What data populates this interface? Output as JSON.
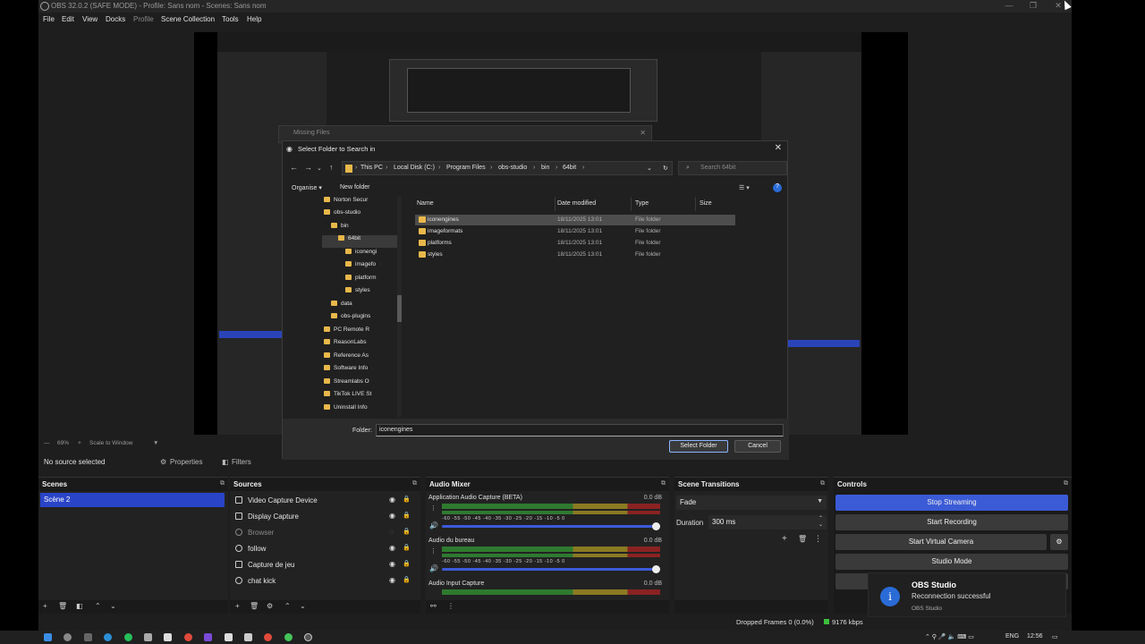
{
  "window": {
    "title": "OBS 32.0.2 (SAFE MODE) - Profile: Sans nom - Scenes: Sans nom",
    "menu": [
      "File",
      "Edit",
      "View",
      "Docks",
      "Profile",
      "Scene Collection",
      "Tools",
      "Help"
    ]
  },
  "missing_dialog": {
    "title": "Missing Files"
  },
  "folder_dialog": {
    "title": "Select Folder to Search in",
    "breadcrumb": [
      "This PC",
      "Local Disk (C:)",
      "Program Files",
      "obs-studio",
      "bin",
      "64bit"
    ],
    "search_placeholder": "Search 64bit",
    "toolbar": {
      "organise": "Organise ▾",
      "new_folder": "New folder"
    },
    "tree": [
      "Norton Secur",
      "obs-studio",
      "bin",
      "64bit",
      "iconengi",
      "imagefo",
      "platform",
      "styles",
      "data",
      "obs-plugins",
      "PC Remote R",
      "ReasonLabs",
      "Reference As",
      "Software Info",
      "Streamlabs O",
      "TikTok LIVE St",
      "Uninstall Info"
    ],
    "columns": {
      "name": "Name",
      "date": "Date modified",
      "type": "Type",
      "size": "Size"
    },
    "files": [
      {
        "name": "iconengines",
        "date": "18/11/2025 13:01",
        "type": "File folder"
      },
      {
        "name": "imageformats",
        "date": "18/11/2025 13:01",
        "type": "File folder"
      },
      {
        "name": "platforms",
        "date": "18/11/2025 13:01",
        "type": "File folder"
      },
      {
        "name": "styles",
        "date": "18/11/2025 13:01",
        "type": "File folder"
      }
    ],
    "folder_label": "Folder:",
    "folder_value": "iconengines",
    "select_btn": "Select Folder",
    "cancel_btn": "Cancel"
  },
  "zoombar": {
    "zoom": "69%",
    "scale": "Scale to Window"
  },
  "sourcebar": {
    "none": "No source selected",
    "properties": "Properties",
    "filters": "Filters"
  },
  "scenes": {
    "header": "Scenes",
    "items": [
      "Scène 2"
    ]
  },
  "sources": {
    "header": "Sources",
    "items": [
      {
        "label": "Video Capture Device",
        "dim": false
      },
      {
        "label": "Display Capture",
        "dim": false
      },
      {
        "label": "Browser",
        "dim": true
      },
      {
        "label": "follow",
        "dim": false
      },
      {
        "label": "Capture de jeu",
        "dim": false
      },
      {
        "label": "chat kick",
        "dim": false
      }
    ]
  },
  "mixer": {
    "header": "Audio Mixer",
    "ticks": "-60  -55  -50  -45  -40  -35  -30  -25  -20  -15  -10   -5   0",
    "channels": [
      {
        "name": "Application Audio Capture (BETA)",
        "db": "0.0 dB"
      },
      {
        "name": "Audio du bureau",
        "db": "0.0 dB"
      },
      {
        "name": "Audio Input Capture",
        "db": "0.0 dB"
      }
    ]
  },
  "transitions": {
    "header": "Scene Transitions",
    "type": "Fade",
    "duration_label": "Duration",
    "duration": "300 ms"
  },
  "controls": {
    "header": "Controls",
    "stop_streaming": "Stop Streaming",
    "start_recording": "Start Recording",
    "virtual_camera": "Start Virtual Camera",
    "studio_mode": "Studio Mode"
  },
  "toast": {
    "title": "OBS Studio",
    "message": "Reconnection successful",
    "source": "OBS Studio",
    "icon": "i"
  },
  "statusbar": {
    "dropped": "Dropped Frames 0 (0.0%)",
    "kbps": "9176 kbps"
  },
  "taskbar": {
    "lang": "ENG",
    "time": "12:56"
  }
}
